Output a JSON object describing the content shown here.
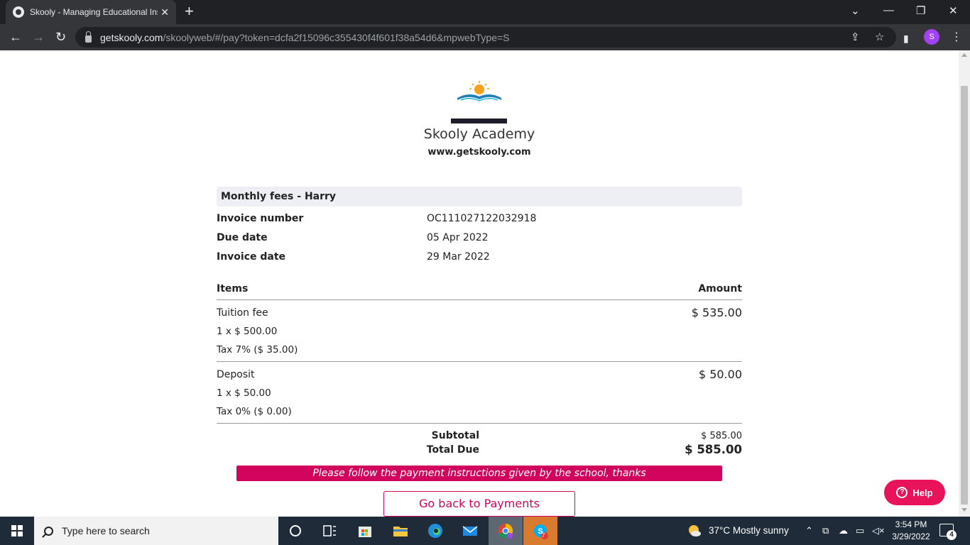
{
  "browser": {
    "tab_title": "Skooly - Managing Educational Ins",
    "url_host": "getskooly.com",
    "url_path": "/skoolyweb/#/pay?token=dcfa2f15096c355430f4f601f38a54d6&mpwebType=S",
    "profile_initial": "S",
    "icons": [
      "back-icon",
      "forward-icon",
      "reload-icon",
      "lock-icon",
      "share-icon",
      "star-icon",
      "sidepanel-icon",
      "menu-icon"
    ]
  },
  "school": {
    "name": "Skooly Academy",
    "website": "www.getskooly.com"
  },
  "invoice": {
    "title": "Monthly fees - Harry",
    "meta": [
      {
        "label": "Invoice number",
        "value": "OC111027122032918"
      },
      {
        "label": "Due date",
        "value": "05 Apr 2022"
      },
      {
        "label": "Invoice date",
        "value": "29 Mar 2022"
      }
    ],
    "items_header": "Items",
    "amount_header": "Amount",
    "items": [
      {
        "name": "Tuition fee",
        "amount": "$ 535.00",
        "qty": "1 x $ 500.00",
        "tax": "Tax 7% ($ 35.00)"
      },
      {
        "name": "Deposit",
        "amount": "$ 50.00",
        "qty": "1 x $ 50.00",
        "tax": "Tax 0% ($ 0.00)"
      }
    ],
    "subtotal_label": "Subtotal",
    "subtotal_value": "$ 585.00",
    "total_label": "Total Due",
    "total_value": "$ 585.00"
  },
  "notice": "Please follow the payment instructions given by the school, thanks",
  "back_button": "Go back to Payments",
  "help_button": "Help",
  "colors": {
    "accent": "#d1045e",
    "help": "#e8135a"
  },
  "taskbar": {
    "search_placeholder": "Type here to search",
    "weather": "37°C  Mostly sunny",
    "time": "3:54 PM",
    "date": "3/29/2022",
    "notification_count": "4",
    "skype_badge": "7"
  }
}
